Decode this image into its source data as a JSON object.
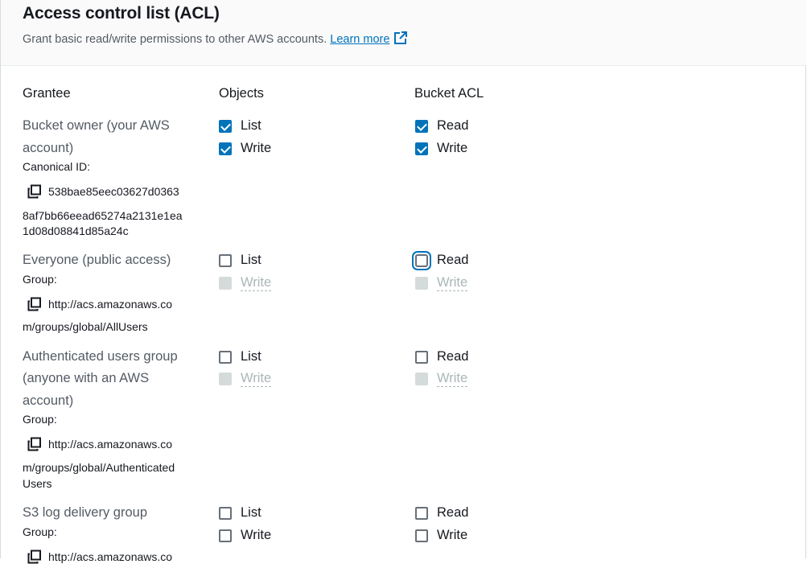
{
  "header": {
    "title": "Access control list (ACL)",
    "description": "Grant basic read/write permissions to other AWS accounts.",
    "learn_more": "Learn more"
  },
  "columns": {
    "grantee": "Grantee",
    "objects": "Objects",
    "bucket_acl": "Bucket ACL"
  },
  "rows": {
    "owner": {
      "name_line1": "Bucket owner (your AWS",
      "name_line2": "account)",
      "id_label": "Canonical ID:",
      "id_line1": "538bae85eec03627d0363",
      "id_line2": "8af7bb66eead65274a2131e1ea",
      "id_line3": "1d08d08841d85a24c",
      "objects_list": "List",
      "objects_list_checked": true,
      "objects_write": "Write",
      "objects_write_checked": true,
      "acl_read": "Read",
      "acl_read_checked": true,
      "acl_write": "Write",
      "acl_write_checked": true
    },
    "everyone": {
      "name_line1": "Everyone (public access)",
      "id_label": "Group:",
      "id_line1": "http://acs.amazonaws.co",
      "id_line2": "m/groups/global/AllUsers",
      "objects_list": "List",
      "objects_write": "Write",
      "acl_read": "Read",
      "acl_write": "Write"
    },
    "authenticated": {
      "name_line1": "Authenticated users group",
      "name_line2": "(anyone with an AWS",
      "name_line3": "account)",
      "id_label": "Group:",
      "id_line1": "http://acs.amazonaws.co",
      "id_line2": "m/groups/global/Authenticated",
      "id_line3": "Users",
      "objects_list": "List",
      "objects_write": "Write",
      "acl_read": "Read",
      "acl_write": "Write"
    },
    "logdelivery": {
      "name_line1": "S3 log delivery group",
      "id_label": "Group:",
      "id_line1": "http://acs.amazonaws.co",
      "objects_list": "List",
      "objects_write": "Write",
      "acl_read": "Read",
      "acl_write": "Write"
    }
  },
  "icons": {
    "external": "external-link-icon",
    "copy": "copy-icon"
  },
  "colors": {
    "link": "#0073bb",
    "checkbox_checked": "#0073bb",
    "disabled": "#aab7b8"
  }
}
